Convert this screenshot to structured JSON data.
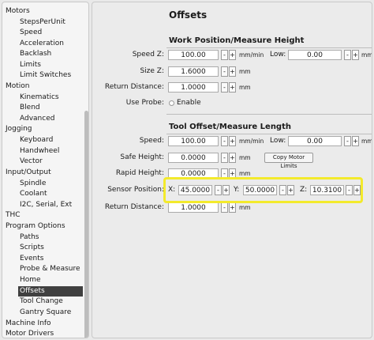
{
  "sidebar": {
    "items": [
      {
        "label": "Motors"
      },
      {
        "label": "StepsPerUnit"
      },
      {
        "label": "Speed"
      },
      {
        "label": "Acceleration"
      },
      {
        "label": "Backlash"
      },
      {
        "label": "Limits"
      },
      {
        "label": "Limit Switches"
      },
      {
        "label": "Motion"
      },
      {
        "label": "Kinematics"
      },
      {
        "label": "Blend"
      },
      {
        "label": "Advanced"
      },
      {
        "label": "Jogging"
      },
      {
        "label": "Keyboard"
      },
      {
        "label": "Handwheel"
      },
      {
        "label": "Vector"
      },
      {
        "label": "Input/Output"
      },
      {
        "label": "Spindle"
      },
      {
        "label": "Coolant"
      },
      {
        "label": "I2C, Serial, Ext"
      },
      {
        "label": "THC"
      },
      {
        "label": "Program Options"
      },
      {
        "label": "Paths"
      },
      {
        "label": "Scripts"
      },
      {
        "label": "Events"
      },
      {
        "label": "Probe & Measure"
      },
      {
        "label": "Home"
      },
      {
        "label": "Offsets"
      },
      {
        "label": "Tool Change"
      },
      {
        "label": "Gantry Square"
      },
      {
        "label": "Machine Info"
      },
      {
        "label": "Motor Drivers"
      }
    ]
  },
  "main": {
    "title": "Offsets",
    "work": {
      "heading": "Work Position/Measure Height",
      "speed_label": "Speed Z:",
      "speed_value": "100.00",
      "speed_unit": "mm/min",
      "low_label": "Low:",
      "low_value": "0.00",
      "low_unit": "mm/min",
      "size_label": "Size Z:",
      "size_value": "1.6000",
      "size_unit": "mm",
      "return_label": "Return Distance:",
      "return_value": "1.0000",
      "return_unit": "mm",
      "use_probe_label": "Use Probe:",
      "enable_label": "Enable"
    },
    "tool": {
      "heading": "Tool Offset/Measure Length",
      "speed_label": "Speed:",
      "speed_value": "100.00",
      "speed_unit": "mm/min",
      "low_label": "Low:",
      "low_value": "0.00",
      "low_unit": "mm/min",
      "safe_label": "Safe Height:",
      "safe_value": "0.0000",
      "safe_unit": "mm",
      "copy_button": "Copy Motor Limits",
      "rapid_label": "Rapid Height:",
      "rapid_value": "0.0000",
      "rapid_unit": "mm",
      "sensor_label": "Sensor Position:",
      "x_label": "X:",
      "x_value": "45.0000",
      "y_label": "Y:",
      "y_value": "50.0000",
      "z_label": "Z:",
      "z_value": "10.3100",
      "return_label": "Return Distance:",
      "return_value": "1.0000",
      "return_unit": "mm"
    },
    "minus": "-",
    "plus": "+"
  },
  "colors": {
    "highlight": "#f3ea2c",
    "selected_bg": "#404040"
  }
}
